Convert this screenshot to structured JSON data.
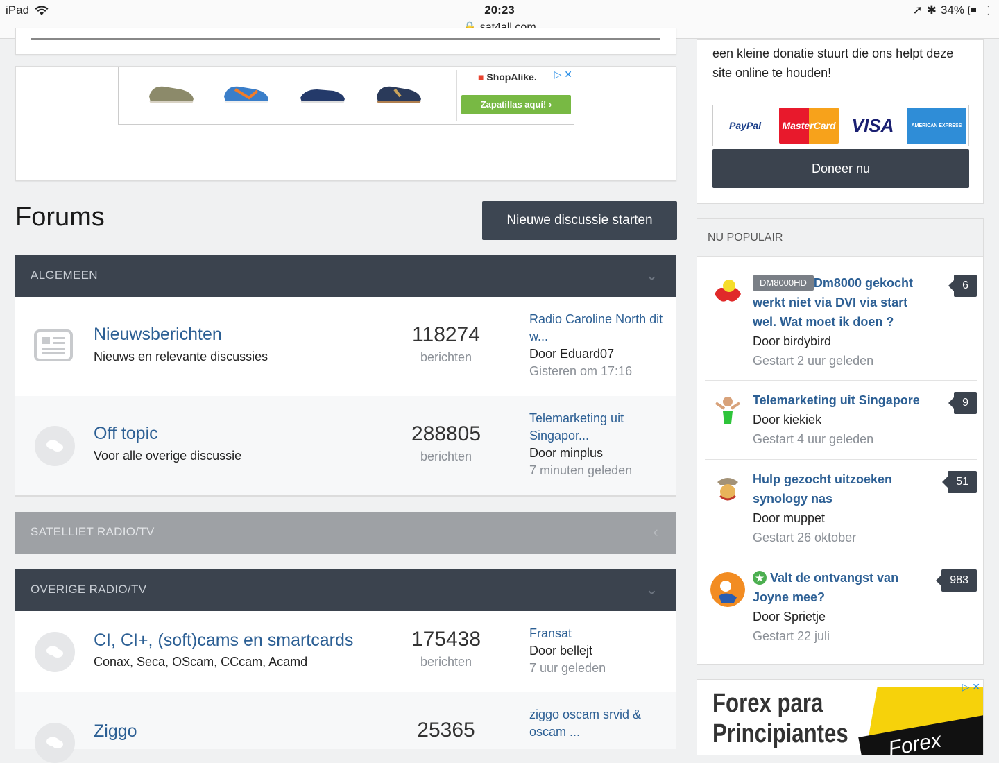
{
  "status_bar": {
    "device": "iPad",
    "time": "20:23",
    "url": "sat4all.com",
    "battery": "34%",
    "battery_level": 0.34
  },
  "ad_top": {
    "brand": "ShopAlike.",
    "cta": "Zapatillas aquí!"
  },
  "forums": {
    "title": "Forums",
    "new_button": "Nieuwe discussie starten"
  },
  "categories": [
    {
      "name": "ALGEMEEN",
      "forums": [
        {
          "title": "Nieuwsberichten",
          "desc": "Nieuws en relevante discussies",
          "count": "118274",
          "count_label": "berichten",
          "last_title": "Radio Caroline North dit w...",
          "last_author": "Door Eduard07",
          "last_date": "Gisteren om 17:16"
        },
        {
          "title": "Off topic",
          "desc": "Voor alle overige discussie",
          "count": "288805",
          "count_label": "berichten",
          "last_title": "Telemarketing uit Singapor...",
          "last_author": "Door minplus",
          "last_date": "7 minuten geleden"
        }
      ]
    },
    {
      "name": "SATELLIET RADIO/TV",
      "forums": []
    },
    {
      "name": "OVERIGE RADIO/TV",
      "forums": [
        {
          "title": "CI, CI+, (soft)cams en smartcards",
          "desc": "Conax, Seca, OScam, CCcam, Acamd",
          "count": "175438",
          "count_label": "berichten",
          "last_title": "Fransat",
          "last_author": "Door bellejt",
          "last_date": "7 uur geleden"
        },
        {
          "title": "Ziggo",
          "desc": "",
          "count": "25365",
          "count_label": "",
          "last_title": "ziggo oscam srvid & oscam ...",
          "last_author": "",
          "last_date": ""
        }
      ]
    }
  ],
  "sidebar": {
    "donate_text": "een kleine donatie stuurt die ons helpt deze site online te houden!",
    "payments": [
      "PayPal",
      "MasterCard",
      "VISA",
      "AMERICAN EXPRESS"
    ],
    "donate_button": "Doneer nu",
    "popular_title": "NU POPULAIR",
    "popular": [
      {
        "tag": "DM8000HD",
        "title": "Dm8000 gekocht werkt niet via DVI via start wel. Wat moet ik doen ?",
        "author": "Door birdybird",
        "date": "Gestart 2 uur geleden",
        "count": "6"
      },
      {
        "tag": "",
        "title": "Telemarketing uit Singapore",
        "author": "Door kiekiek",
        "date": "Gestart 4 uur geleden",
        "count": "9"
      },
      {
        "tag": "",
        "title": "Hulp gezocht uitzoeken synology nas",
        "author": "Door muppet",
        "date": "Gestart 26 oktober",
        "count": "51"
      },
      {
        "tag": "",
        "title": "Valt de ontvangst van Joyne mee?",
        "author": "Door Sprietje",
        "date": "Gestart 22 juli",
        "count": "983"
      }
    ],
    "forex_line1": "Forex para",
    "forex_line2": "Principiantes",
    "forex_logo": "Forex"
  },
  "colors": {
    "accent_link": "#2c5f94",
    "dark_header": "#3b434e",
    "muted": "#8a8f96"
  }
}
